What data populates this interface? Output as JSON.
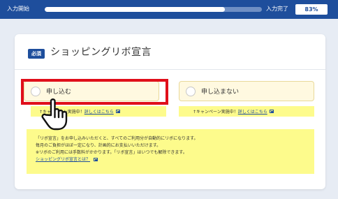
{
  "progress": {
    "start_label": "入力開始",
    "end_label": "入力完了",
    "percent_label": "83%",
    "fraction": 0.83
  },
  "card": {
    "badge": "必須",
    "title": "ショッピングリボ宣言"
  },
  "options": [
    {
      "label": "申し込む"
    },
    {
      "label": "申し込まない"
    }
  ],
  "campaign": {
    "left_prefix": "↑キャンペーン実施中！",
    "right_prefix": "↑キャンペーン実施中！",
    "link": "詳しくはこちら"
  },
  "note": {
    "line1": "「リボ宣言」をお申し込みいただくと、すべてのご利用分が自動的にリボになります。",
    "line2": "毎月のご負担がほぼ一定になり、計画的にお支払いいただけます。",
    "line3": "※リボのご利用には手数料がかかります。「リボ宣言」はいつでも解除できます。",
    "link": "ショッピングリボ宣言とは？"
  },
  "colors": {
    "brand": "#1e4e9c",
    "highlight": "#e00f1a",
    "note_bg": "#fdfb8c"
  },
  "icons": [
    "pointer-hand-icon",
    "external-link-icon"
  ]
}
